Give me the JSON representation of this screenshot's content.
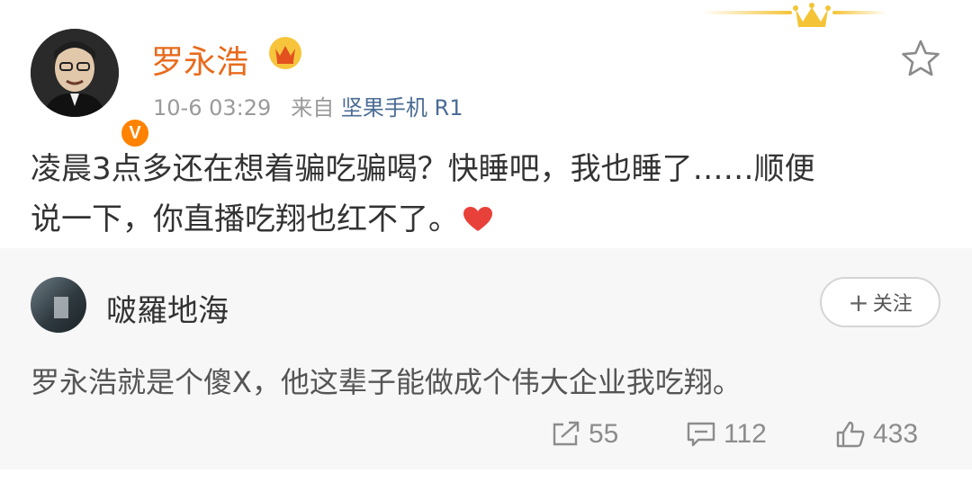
{
  "post": {
    "author": "罗永浩",
    "time": "10-6 03:29",
    "source_prefix": "来自",
    "source": "坚果手机 R1",
    "body_line1": "凌晨3点多还在想着骗吃骗喝？快睡吧，我也睡了……顺便",
    "body_line2": "说一下，你直播吃翔也红不了。",
    "verified_mark": "V"
  },
  "comment": {
    "author": "啵羅地海",
    "follow_label": "关注",
    "follow_plus": "+",
    "text": "罗永浩就是个傻X，他这辈子能做成个伟大企业我吃翔。",
    "reposts": "55",
    "comments": "112",
    "likes": "433"
  },
  "colors": {
    "author_orange": "#e86b1d",
    "link_blue": "#4a6c96",
    "verified_orange": "#ff8200",
    "heart_red": "#e8413a",
    "card_bg": "#f7f7f7"
  },
  "icons": [
    "crown-icon",
    "vip-crown-icon",
    "star-icon",
    "verified-icon",
    "heart-icon",
    "repost-icon",
    "comment-icon",
    "like-icon"
  ]
}
